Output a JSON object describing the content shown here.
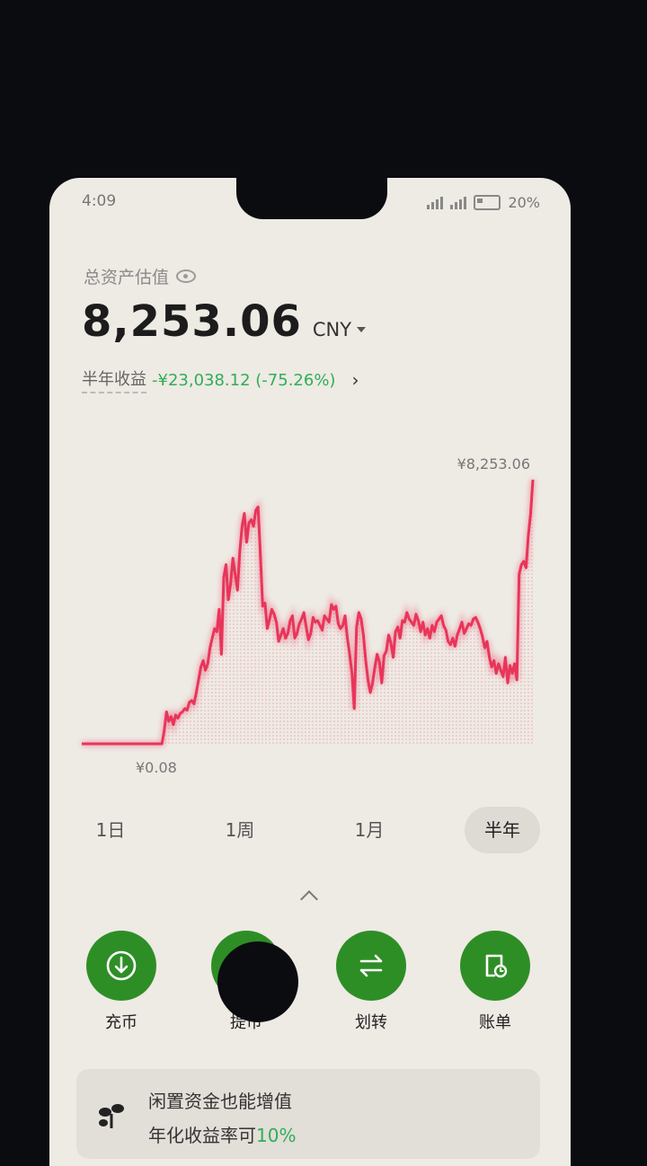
{
  "status_bar": {
    "time": "4:09",
    "battery": "20%"
  },
  "header": {
    "asset_label": "总资产估值",
    "total_amount": "8,253.06",
    "currency": "CNY",
    "pnl_label": "半年收益",
    "pnl_value": "-¥23,038.12 (-75.26%)"
  },
  "chart_data": {
    "type": "area",
    "max_label": "¥8,253.06",
    "min_label": "¥0.08",
    "line_color": "#e8355a",
    "values": [
      0.08,
      0.08,
      0.08,
      0.08,
      0.08,
      0.08,
      0.08,
      0.08,
      0.08,
      0.08,
      0.08,
      0.08,
      0.08,
      0.08,
      0.08,
      0.08,
      0.08,
      0.08,
      0.08,
      0.08,
      0.08,
      0.08,
      0.08,
      0.08,
      0.08,
      0.08,
      0.08,
      0.08,
      0.08,
      0.08,
      0.08,
      0.08,
      0.08,
      0.08,
      0.08,
      0.08,
      400,
      1000,
      700,
      850,
      600,
      900,
      800,
      950,
      1000,
      1100,
      1050,
      1300,
      1350,
      1250,
      1600,
      2000,
      2400,
      2600,
      2300,
      2500,
      3000,
      3300,
      3600,
      3500,
      4200,
      2800,
      5200,
      5600,
      4500,
      5000,
      5800,
      5300,
      4800,
      6000,
      6800,
      7200,
      6300,
      6900,
      7000,
      6800,
      7300,
      7400,
      5900,
      4300,
      4400,
      3600,
      3900,
      4200,
      4050,
      3800,
      3200,
      3400,
      3600,
      3300,
      3450,
      3850,
      4000,
      3300,
      3450,
      3750,
      3900,
      4100,
      3650,
      3250,
      3450,
      3950,
      3800,
      3850,
      3700,
      3550,
      4000,
      3900,
      3800,
      4350,
      4200,
      4300,
      3750,
      3600,
      3700,
      4000,
      3300,
      2800,
      2200,
      1100,
      3650,
      4100,
      3900,
      3400,
      2600,
      2000,
      1600,
      1900,
      2400,
      2800,
      2550,
      1900,
      2750,
      2900,
      3400,
      3150,
      2700,
      3500,
      3650,
      3300,
      3850,
      3800,
      4100,
      3900,
      3800,
      3700,
      4050,
      3850,
      3500,
      3800,
      3400,
      3600,
      3300,
      3700,
      3500,
      3800,
      3900,
      4000,
      3700,
      3550,
      3200,
      3100,
      3300,
      3050,
      3400,
      3600,
      3800,
      3450,
      3600,
      3750,
      3700,
      3900,
      3950,
      3800,
      3600,
      3350,
      3000,
      3200,
      2700,
      2400,
      2600,
      2200,
      2500,
      2300,
      2100,
      2700,
      1900,
      2450,
      2200,
      2500,
      2000,
      5300,
      5600,
      5700,
      5500,
      6500,
      7200,
      8253.06
    ]
  },
  "tabs": [
    {
      "label": "1日"
    },
    {
      "label": "1周"
    },
    {
      "label": "1月"
    },
    {
      "label": "半年",
      "active": true
    }
  ],
  "actions": [
    {
      "label": "充币",
      "icon": "deposit-icon"
    },
    {
      "label": "提币",
      "icon": "withdraw-icon"
    },
    {
      "label": "划转",
      "icon": "transfer-icon"
    },
    {
      "label": "账单",
      "icon": "bill-icon"
    }
  ],
  "promo": {
    "title": "闲置资金也能增值",
    "subtitle_a": "年化收益率可",
    "subtitle_b": "10%"
  },
  "colors": {
    "accent": "#2e8e26",
    "gain": "#2fae57",
    "chart_line": "#e8355a"
  }
}
